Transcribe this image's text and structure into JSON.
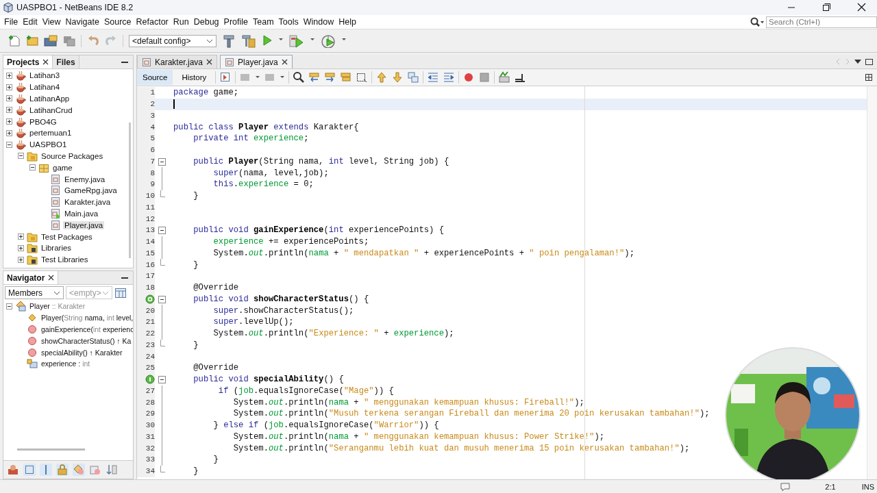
{
  "window": {
    "title": "UASPBO1 - NetBeans IDE 8.2"
  },
  "menu": [
    "File",
    "Edit",
    "View",
    "Navigate",
    "Source",
    "Refactor",
    "Run",
    "Debug",
    "Profile",
    "Team",
    "Tools",
    "Window",
    "Help"
  ],
  "toolbar": {
    "config": "<default config>"
  },
  "search": {
    "placeholder": "Search (Ctrl+I)"
  },
  "projects_panel": {
    "tabs": [
      {
        "label": "Projects",
        "selected": true
      },
      {
        "label": "Files",
        "selected": false
      }
    ],
    "tree": [
      {
        "label": "Latihan3",
        "kind": "project",
        "expanded": false
      },
      {
        "label": "Latihan4",
        "kind": "project",
        "expanded": false
      },
      {
        "label": "LatihanApp",
        "kind": "project",
        "expanded": false
      },
      {
        "label": "LatihanCrud",
        "kind": "project",
        "expanded": false
      },
      {
        "label": "PBO4G",
        "kind": "project",
        "expanded": false
      },
      {
        "label": "pertemuan1",
        "kind": "project",
        "expanded": false
      },
      {
        "label": "UASPBO1",
        "kind": "project",
        "expanded": true,
        "children": [
          {
            "label": "Source Packages",
            "kind": "folder",
            "expanded": true,
            "children": [
              {
                "label": "game",
                "kind": "package",
                "expanded": true,
                "children": [
                  {
                    "label": "Enemy.java",
                    "kind": "file",
                    "selected": false
                  },
                  {
                    "label": "GameRpg.java",
                    "kind": "file",
                    "selected": false
                  },
                  {
                    "label": "Karakter.java",
                    "kind": "file",
                    "selected": false
                  },
                  {
                    "label": "Main.java",
                    "kind": "mainfile",
                    "selected": false
                  },
                  {
                    "label": "Player.java",
                    "kind": "file",
                    "selected": true
                  }
                ]
              }
            ]
          },
          {
            "label": "Test Packages",
            "kind": "folder",
            "expanded": false
          },
          {
            "label": "Libraries",
            "kind": "library",
            "expanded": false
          },
          {
            "label": "Test Libraries",
            "kind": "library",
            "expanded": false
          }
        ]
      }
    ]
  },
  "navigator": {
    "title": "Navigator",
    "filter": "Members",
    "scope": "<empty>",
    "root": {
      "parts": [
        {
          "text": "Player",
          "muted": false
        },
        {
          "text": ":: Karakter",
          "muted": true
        }
      ],
      "expanded": true,
      "kind": "class"
    },
    "members": [
      {
        "kind": "constructor",
        "parts": [
          {
            "text": "Player(",
            "muted": false
          },
          {
            "text": "String",
            "muted": true
          },
          {
            "text": "nama,",
            "muted": false
          },
          {
            "text": "int",
            "muted": true
          },
          {
            "text": "level,",
            "muted": false
          }
        ]
      },
      {
        "kind": "method",
        "parts": [
          {
            "text": "gainExperience(",
            "muted": false
          },
          {
            "text": "int",
            "muted": true
          },
          {
            "text": "experienc",
            "muted": false
          }
        ]
      },
      {
        "kind": "method",
        "parts": [
          {
            "text": "showCharacterStatus() ↑ Ka",
            "muted": false
          }
        ]
      },
      {
        "kind": "method",
        "parts": [
          {
            "text": "specialAbility() ↑ Karakter",
            "muted": false
          }
        ]
      },
      {
        "kind": "field",
        "parts": [
          {
            "text": "experience :",
            "muted": false
          },
          {
            "text": "int",
            "muted": true
          }
        ]
      }
    ]
  },
  "editor": {
    "tabs": [
      {
        "label": "Karakter.java",
        "selected": false
      },
      {
        "label": "Player.java",
        "selected": true
      }
    ],
    "views": [
      {
        "label": "Source",
        "selected": true
      },
      {
        "label": "History",
        "selected": false
      }
    ],
    "lines": [
      {
        "number": "1",
        "tokens": [
          {
            "kind": "keyword",
            "text": "package"
          },
          {
            "kind": "plain",
            "text": " game;"
          }
        ]
      },
      {
        "number": "2",
        "current": true
      },
      {
        "number": "3"
      },
      {
        "number": "4",
        "tokens": [
          {
            "kind": "keyword",
            "text": "public class "
          },
          {
            "kind": "decl",
            "text": "Player"
          },
          {
            "kind": "keyword",
            "text": " extends"
          },
          {
            "kind": "plain",
            "text": " Karakter{"
          }
        ]
      },
      {
        "number": "5",
        "tokens": [
          {
            "kind": "keyword",
            "text": "    private int "
          },
          {
            "kind": "field",
            "text": "experience"
          },
          {
            "kind": "plain",
            "text": ";"
          }
        ]
      },
      {
        "number": "6"
      },
      {
        "number": "7",
        "fold_start": true,
        "tokens": [
          {
            "kind": "keyword",
            "text": "    public "
          },
          {
            "kind": "decl",
            "text": "Player"
          },
          {
            "kind": "plain",
            "text": "(String nama, "
          },
          {
            "kind": "keyword",
            "text": "int"
          },
          {
            "kind": "plain",
            "text": " level, String job) {"
          }
        ]
      },
      {
        "number": "8",
        "in_fold": true,
        "tokens": [
          {
            "kind": "keyword",
            "text": "        super"
          },
          {
            "kind": "plain",
            "text": "(nama, level,job);"
          }
        ]
      },
      {
        "number": "9",
        "in_fold": true,
        "tokens": [
          {
            "kind": "keyword",
            "text": "        this"
          },
          {
            "kind": "plain",
            "text": "."
          },
          {
            "kind": "field",
            "text": "experience"
          },
          {
            "kind": "plain",
            "text": " = 0;"
          }
        ]
      },
      {
        "number": "10",
        "fold_end": true,
        "tokens": [
          {
            "kind": "plain",
            "text": "    }"
          }
        ]
      },
      {
        "number": "11"
      },
      {
        "number": "12"
      },
      {
        "number": "13",
        "fold_start": true,
        "tokens": [
          {
            "kind": "keyword",
            "text": "    public void "
          },
          {
            "kind": "decl",
            "text": "gainExperience"
          },
          {
            "kind": "plain",
            "text": "("
          },
          {
            "kind": "keyword",
            "text": "int"
          },
          {
            "kind": "plain",
            "text": " experiencePoints) {"
          }
        ]
      },
      {
        "number": "14",
        "in_fold": true,
        "tokens": [
          {
            "kind": "field",
            "text": "        experience"
          },
          {
            "kind": "plain",
            "text": " += experiencePoints;"
          }
        ]
      },
      {
        "number": "15",
        "in_fold": true,
        "tokens": [
          {
            "kind": "plain",
            "text": "        System."
          },
          {
            "kind": "static",
            "text": "out"
          },
          {
            "kind": "plain",
            "text": ".println("
          },
          {
            "kind": "field",
            "text": "nama"
          },
          {
            "kind": "plain",
            "text": " + "
          },
          {
            "kind": "string",
            "text": "\" mendapatkan \""
          },
          {
            "kind": "plain",
            "text": " + experiencePoints + "
          },
          {
            "kind": "string",
            "text": "\" poin pengalaman!\""
          },
          {
            "kind": "plain",
            "text": ");"
          }
        ]
      },
      {
        "number": "16",
        "fold_end": true,
        "tokens": [
          {
            "kind": "plain",
            "text": "    }"
          }
        ]
      },
      {
        "number": "17"
      },
      {
        "number": "18",
        "tokens": [
          {
            "kind": "plain",
            "text": "    @Override"
          }
        ]
      },
      {
        "marker": {
          "kind": "override"
        },
        "fold_start": true,
        "tokens": [
          {
            "kind": "keyword",
            "text": "    public void "
          },
          {
            "kind": "decl",
            "text": "showCharacterStatus"
          },
          {
            "kind": "plain",
            "text": "() {"
          }
        ]
      },
      {
        "number": "20",
        "in_fold": true,
        "tokens": [
          {
            "kind": "keyword",
            "text": "        super"
          },
          {
            "kind": "plain",
            "text": ".showCharacterStatus();"
          }
        ]
      },
      {
        "number": "21",
        "in_fold": true,
        "tokens": [
          {
            "kind": "keyword",
            "text": "        super"
          },
          {
            "kind": "plain",
            "text": ".levelUp();"
          }
        ]
      },
      {
        "number": "22",
        "in_fold": true,
        "tokens": [
          {
            "kind": "plain",
            "text": "        System."
          },
          {
            "kind": "static",
            "text": "out"
          },
          {
            "kind": "plain",
            "text": ".println("
          },
          {
            "kind": "string",
            "text": "\"Experience: \""
          },
          {
            "kind": "plain",
            "text": " + "
          },
          {
            "kind": "field",
            "text": "experience"
          },
          {
            "kind": "plain",
            "text": ");"
          }
        ]
      },
      {
        "number": "23",
        "fold_end": true,
        "tokens": [
          {
            "kind": "plain",
            "text": "    }"
          }
        ]
      },
      {
        "number": "24"
      },
      {
        "number": "25",
        "tokens": [
          {
            "kind": "plain",
            "text": "    @Override"
          }
        ]
      },
      {
        "marker": {
          "kind": "implements"
        },
        "fold_start": true,
        "tokens": [
          {
            "kind": "keyword",
            "text": "    public void "
          },
          {
            "kind": "decl",
            "text": "specialAbility"
          },
          {
            "kind": "plain",
            "text": "() {"
          }
        ]
      },
      {
        "number": "27",
        "in_fold": true,
        "tokens": [
          {
            "kind": "keyword",
            "text": "         if"
          },
          {
            "kind": "plain",
            "text": " ("
          },
          {
            "kind": "field",
            "text": "job"
          },
          {
            "kind": "plain",
            "text": ".equalsIgnoreCase("
          },
          {
            "kind": "string",
            "text": "\"Mage\""
          },
          {
            "kind": "plain",
            "text": ")) {"
          }
        ]
      },
      {
        "number": "28",
        "in_fold": true,
        "tokens": [
          {
            "kind": "plain",
            "text": "            System."
          },
          {
            "kind": "static",
            "text": "out"
          },
          {
            "kind": "plain",
            "text": ".println("
          },
          {
            "kind": "field",
            "text": "nama"
          },
          {
            "kind": "plain",
            "text": " + "
          },
          {
            "kind": "string",
            "text": "\" menggunakan kemampuan khusus: Fireball!\""
          },
          {
            "kind": "plain",
            "text": ");"
          }
        ]
      },
      {
        "number": "29",
        "in_fold": true,
        "tokens": [
          {
            "kind": "plain",
            "text": "            System."
          },
          {
            "kind": "static",
            "text": "out"
          },
          {
            "kind": "plain",
            "text": ".println("
          },
          {
            "kind": "string",
            "text": "\"Musuh terkena serangan Fireball dan menerima 20 poin kerusakan tambahan!\""
          },
          {
            "kind": "plain",
            "text": ");"
          }
        ]
      },
      {
        "number": "30",
        "in_fold": true,
        "tokens": [
          {
            "kind": "plain",
            "text": "        } "
          },
          {
            "kind": "keyword",
            "text": "else if"
          },
          {
            "kind": "plain",
            "text": " ("
          },
          {
            "kind": "field",
            "text": "job"
          },
          {
            "kind": "plain",
            "text": ".equalsIgnoreCase("
          },
          {
            "kind": "string",
            "text": "\"Warrior\""
          },
          {
            "kind": "plain",
            "text": ")) {"
          }
        ]
      },
      {
        "number": "31",
        "in_fold": true,
        "tokens": [
          {
            "kind": "plain",
            "text": "            System."
          },
          {
            "kind": "static",
            "text": "out"
          },
          {
            "kind": "plain",
            "text": ".println("
          },
          {
            "kind": "field",
            "text": "nama"
          },
          {
            "kind": "plain",
            "text": " + "
          },
          {
            "kind": "string",
            "text": "\" menggunakan kemampuan khusus: Power Strike!\""
          },
          {
            "kind": "plain",
            "text": ");"
          }
        ]
      },
      {
        "number": "32",
        "in_fold": true,
        "tokens": [
          {
            "kind": "plain",
            "text": "            System."
          },
          {
            "kind": "static",
            "text": "out"
          },
          {
            "kind": "plain",
            "text": ".println("
          },
          {
            "kind": "string",
            "text": "\"Seranganmu lebih kuat dan musuh menerima 15 poin kerusakan tambahan!\""
          },
          {
            "kind": "plain",
            "text": ");"
          }
        ]
      },
      {
        "number": "33",
        "in_fold": true,
        "tokens": [
          {
            "kind": "plain",
            "text": "        }"
          }
        ]
      },
      {
        "number": "34",
        "fold_end": true,
        "tokens": [
          {
            "kind": "plain",
            "text": "    }"
          }
        ]
      }
    ]
  },
  "status_bar": {
    "position": "2:1",
    "mode": "INS"
  }
}
